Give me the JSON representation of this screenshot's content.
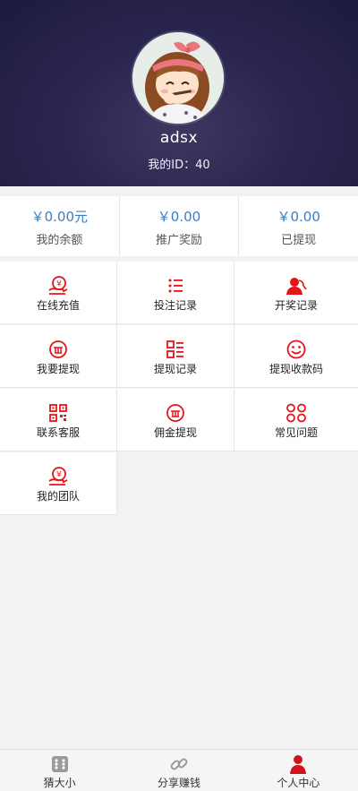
{
  "profile": {
    "username": "adsx",
    "id_text": "我的ID：40"
  },
  "stats": [
    {
      "amount": "￥0.00元",
      "label": "我的余额"
    },
    {
      "amount": "￥0.00",
      "label": "推广奖励"
    },
    {
      "amount": "￥0.00",
      "label": "已提现"
    }
  ],
  "menu": [
    {
      "label": "在线充值",
      "icon": "hand-coin-icon"
    },
    {
      "label": "投注记录",
      "icon": "list-icon"
    },
    {
      "label": "开奖记录",
      "icon": "user-icon"
    },
    {
      "label": "我要提现",
      "icon": "coin-icon"
    },
    {
      "label": "提现记录",
      "icon": "list-grid-icon"
    },
    {
      "label": "提现收款码",
      "icon": "smile-icon"
    },
    {
      "label": "联系客服",
      "icon": "qrcode-icon"
    },
    {
      "label": "佣金提现",
      "icon": "coin-icon"
    },
    {
      "label": "常见问题",
      "icon": "circles-icon"
    },
    {
      "label": "我的团队",
      "icon": "hand-coin-icon"
    }
  ],
  "tabbar": [
    {
      "label": "猜大小",
      "icon": "dice-icon"
    },
    {
      "label": "分享赚钱",
      "icon": "link-icon"
    },
    {
      "label": "个人中心",
      "icon": "person-icon"
    }
  ],
  "colors": {
    "accent": "#e4141b",
    "amount": "#3f7bbf",
    "header": "#2b2650"
  }
}
